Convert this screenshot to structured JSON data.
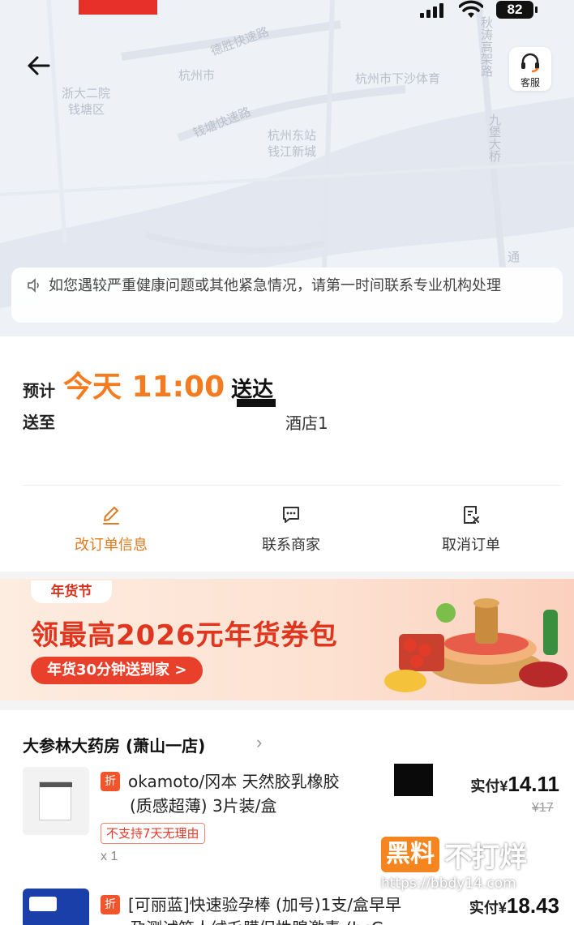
{
  "status_bar": {
    "battery": "82"
  },
  "map": {
    "labels": [
      "德胜快速路",
      "杭州市",
      "杭州市下沙体育",
      "浙大二院",
      "钱塘区",
      "钱塘快速路",
      "杭州东站",
      "钱江新城",
      "九堡大桥",
      "秋涛高架路",
      "通"
    ]
  },
  "header": {
    "service_label": "客服"
  },
  "notice": {
    "text": "如您遇较严重健康问题或其他紧急情况，请第一时间联系专业机构处理"
  },
  "delivery": {
    "eta_prefix": "预计",
    "eta_time": "今天 11:00",
    "eta_suffix": "送达",
    "address_label": "送至",
    "address_tail": "酒店1"
  },
  "actions": [
    {
      "label": "改订单信息",
      "icon": "edit-icon"
    },
    {
      "label": "联系商家",
      "icon": "chat-icon"
    },
    {
      "label": "取消订单",
      "icon": "cancel-doc-icon"
    }
  ],
  "banner": {
    "tag": "年货节",
    "headline": "领最高2026元年货券包",
    "cta": "年货30分钟送到家 >"
  },
  "store": {
    "name": "大参林大药房 (萧山一店)",
    "items": [
      {
        "name_line1": "okamoto/冈本 天然胶乳橡胶",
        "name_line2": "(质感超薄) 3片装/盒",
        "price_label": "实付",
        "currency": "¥",
        "price": "14.11",
        "original": "¥17",
        "tag": "不支持7天无理由",
        "qty": "x 1",
        "discount_badge": "折"
      },
      {
        "name_line1": "[可丽蓝]快速验孕棒 (加号)1支/盒早早",
        "name_line2": "孕测试笔人绒毛膜促性腺激素 (hcG",
        "price_label": "实付",
        "currency": "¥",
        "price": "18.43",
        "discount_badge": "折"
      }
    ]
  },
  "watermark": {
    "brand_orange": "黑料",
    "brand_white": "不打烊",
    "url": "https://bbdy14.com"
  }
}
